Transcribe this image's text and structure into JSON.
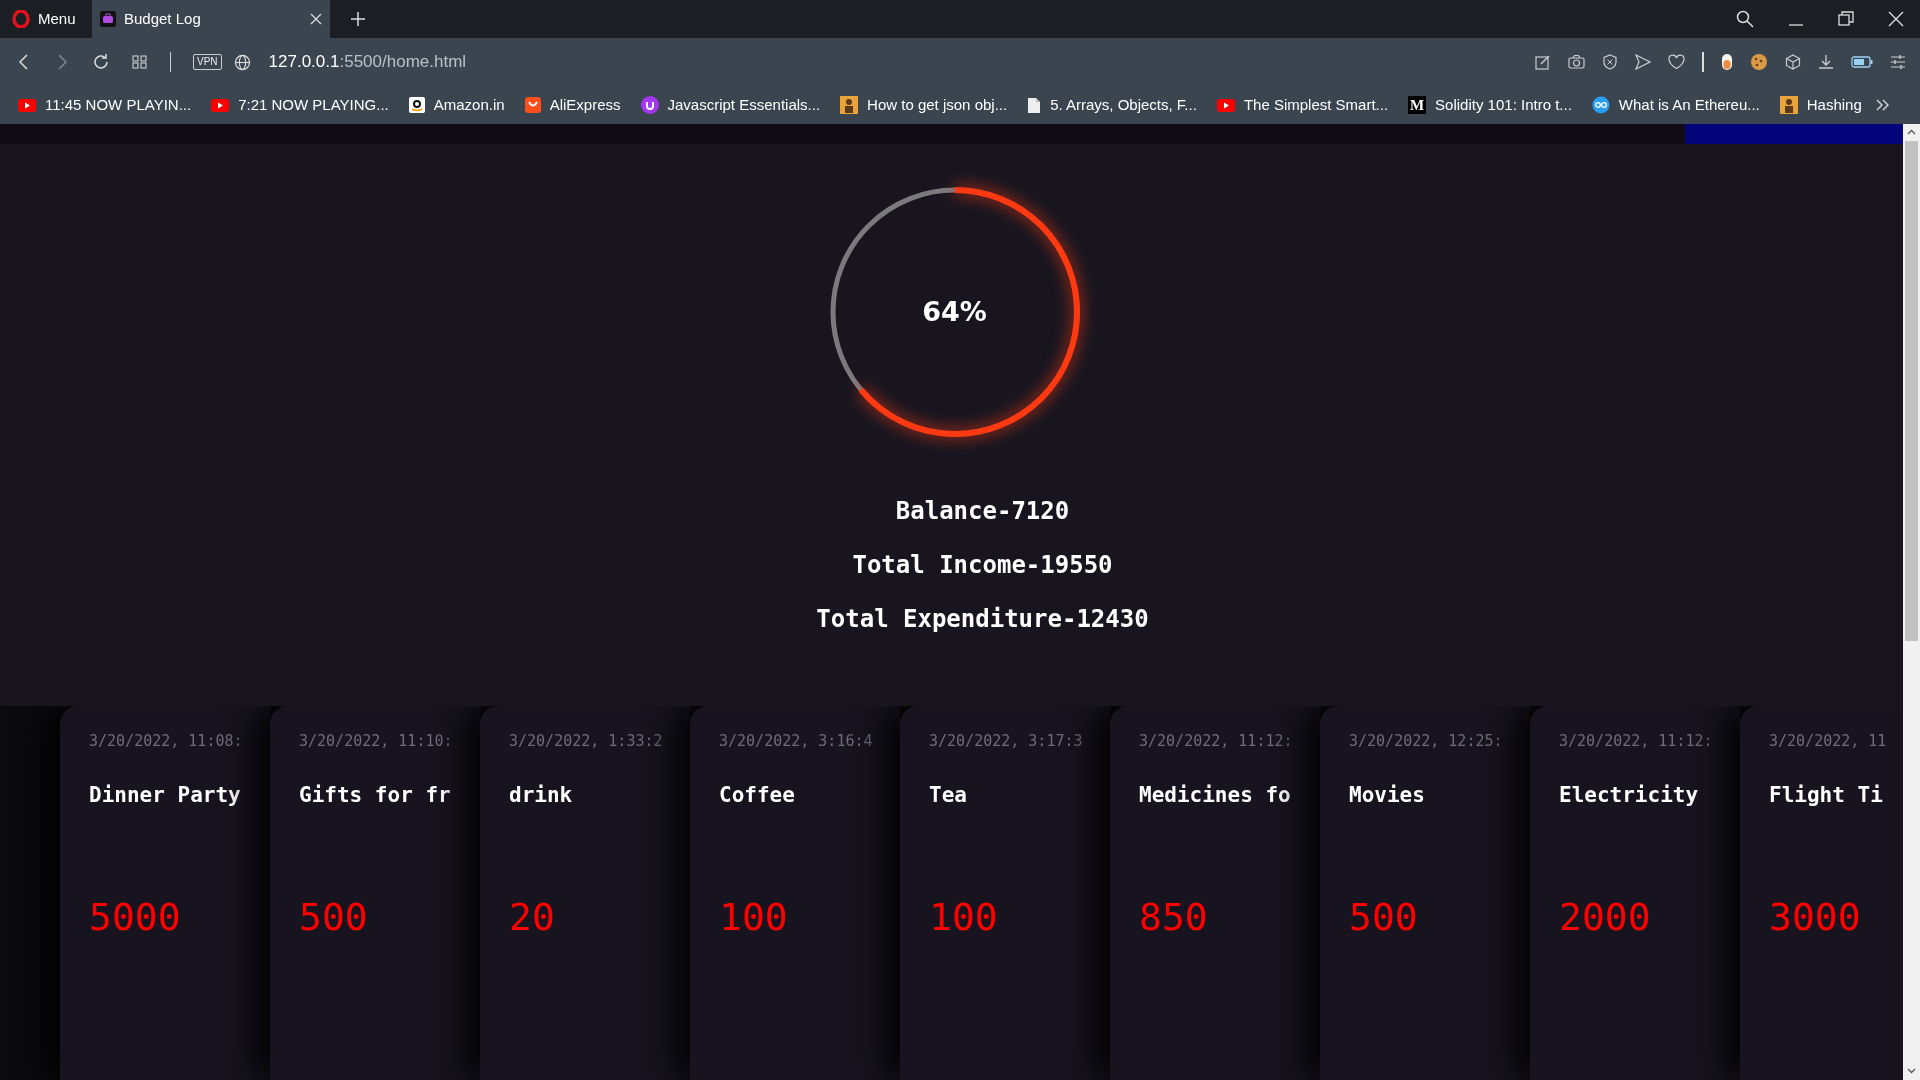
{
  "browser": {
    "menu_label": "Menu",
    "tabs": [
      {
        "title": "Budget Log",
        "selected": true
      }
    ],
    "vpn_label": "VPN",
    "url_host": "127.0.0.1",
    "url_path": ":5500/home.html",
    "bookmarks": [
      {
        "label": "11:45 NOW PLAYIN...",
        "kind": "youtube"
      },
      {
        "label": "7:21 NOW PLAYING...",
        "kind": "youtube"
      },
      {
        "label": "Amazon.in",
        "kind": "amazon"
      },
      {
        "label": "AliExpress",
        "kind": "aliexpress"
      },
      {
        "label": "Javascript Essentials...",
        "kind": "udemy"
      },
      {
        "label": "How to get json obj...",
        "kind": "avatar"
      },
      {
        "label": "5. Arrays, Objects, F...",
        "kind": "document"
      },
      {
        "label": "The Simplest Smart...",
        "kind": "youtube"
      },
      {
        "label": "Solidity 101: Intro t...",
        "kind": "medium",
        "icon_text": "M"
      },
      {
        "label": "What is An Ethereu...",
        "kind": "globe"
      },
      {
        "label": "Hashing",
        "kind": "avatar"
      }
    ]
  },
  "progress": {
    "label": "64%",
    "level": 0.64
  },
  "summary": [
    "Balance-7120",
    "Total Income-19550",
    "Total Expenditure-12430"
  ],
  "transactions": [
    {
      "date": "3/20/2022, 11:08:",
      "title": "Dinner Party",
      "amount": "5000"
    },
    {
      "date": "3/20/2022, 11:10:",
      "title": "Gifts for fr",
      "amount": "500"
    },
    {
      "date": "3/20/2022, 1:33:2",
      "title": "drink",
      "amount": "20"
    },
    {
      "date": "3/20/2022, 3:16:4",
      "title": "Coffee",
      "amount": "100"
    },
    {
      "date": "3/20/2022, 3:17:3",
      "title": "Tea",
      "amount": "100"
    },
    {
      "date": "3/20/2022, 11:12:",
      "title": "Medicines fo",
      "amount": "850"
    },
    {
      "date": "3/20/2022, 12:25:",
      "title": "Movies",
      "amount": "500"
    },
    {
      "date": "3/20/2022, 11:12:",
      "title": "Electricity",
      "amount": "2000"
    },
    {
      "date": "3/20/2022, 11",
      "title": "Flight Ti",
      "amount": "3000"
    }
  ]
}
